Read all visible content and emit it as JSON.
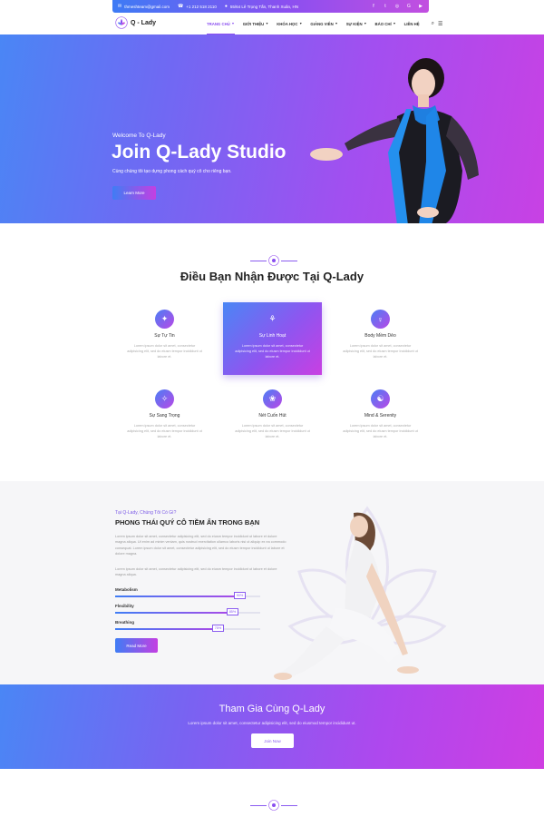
{
  "topbar": {
    "email": "thmeshteam@gmail.com",
    "phone": "+1 212 518 2110",
    "address": "55/64 Lê Trọng Tấn, Thanh Xuân, HN",
    "social_icons": [
      "facebook-icon",
      "twitter-icon",
      "instagram-icon",
      "google-plus-icon",
      "youtube-icon"
    ]
  },
  "header": {
    "logo_text": "Q - Lady",
    "nav": [
      {
        "label": "TRANG CHỦ",
        "dropdown": true,
        "active": true
      },
      {
        "label": "GIỚI THIỆU",
        "dropdown": true
      },
      {
        "label": "KHÓA HỌC",
        "dropdown": true
      },
      {
        "label": "GIẢNG VIÊN",
        "dropdown": true
      },
      {
        "label": "SỰ KIỆN",
        "dropdown": true
      },
      {
        "label": "BÁO CHÍ",
        "dropdown": true
      },
      {
        "label": "LIÊN HỆ",
        "dropdown": false
      }
    ]
  },
  "hero": {
    "welcome": "Welcome To Q-Lady",
    "title": "Join Q-Lady Studio",
    "subtitle": "Cùng chúng tôi tạo dựng phong cách quý cô cho riêng bạn.",
    "button": "Learn More"
  },
  "features": {
    "title": "Điều Bạn Nhận Được Tại Q-Lady",
    "items": [
      {
        "title": "Sự Tự Tin",
        "desc": "Lorem ipsum dolor sit amet, consectetur adipisicing elit, sed do eiusm tempor incididunt ut labore et."
      },
      {
        "title": "Sự Linh Hoạt",
        "desc": "Lorem ipsum dolor sit amet, consectetur adipisicing elit, sed do eiusm tempor incididunt ut labore et."
      },
      {
        "title": "Body Mềm Dẻo",
        "desc": "Lorem ipsum dolor sit amet, consectetur adipisicing elit, sed do eiusm tempor incididunt ut labore et."
      },
      {
        "title": "Sự Sang Trọng",
        "desc": "Lorem ipsum dolor sit amet, consectetur adipisicing elit, sed do eiusm tempor incididunt ut labore et."
      },
      {
        "title": "Nét Cuốn Hút",
        "desc": "Lorem ipsum dolor sit amet, consectetur adipisicing elit, sed do eiusm tempor incididunt ut labore et."
      },
      {
        "title": "Mind & Serenity",
        "desc": "Lorem ipsum dolor sit amet, consectetur adipisicing elit, sed do eiusm tempor incididunt ut labore et."
      }
    ]
  },
  "about": {
    "kicker": "Tại Q-Lady, Chúng Tôi Có Gì?",
    "title": "PHONG THÁI QUÝ CÔ TIỀM ẨN TRONG BẠN",
    "para1": "Lorem ipsum dolor sit amet, consectetur adipisicing elit, sed do eiusm tempor incididunt ut labore et dolore magna aliqua. Ut enim ad minim veniam, quis nostrud exercitation ullamco laboris nisi ut aliquip ex ea commodo consequat. Lorem ipsum dolor sit amet, consectetur adipisicing elit, sed do eiusm tempor incididunt ut labore et dolore magna.",
    "para2": "Lorem ipsum dolor sit amet, consectetur adipisicing elit, sed do eiusm tempor incididunt ut labore et dolore magna aliqua.",
    "skills": [
      {
        "label": "Metabolism",
        "percent": 90,
        "percent_text": "90%"
      },
      {
        "label": "Flexibility",
        "percent": 85,
        "percent_text": "85%"
      },
      {
        "label": "Breathing",
        "percent": 75,
        "percent_text": "75%"
      }
    ],
    "button": "Read More"
  },
  "cta": {
    "title": "Tham Gia Cùng Q-Lady",
    "subtitle": "Lorem ipsum dolor sit amet, consectetur adipisicing elit, sed do eiusmod tempor incididunt ut.",
    "button": "Join Now"
  },
  "colors": {
    "accent": "#8a4ef0",
    "gradient_start": "#4a86f5",
    "gradient_end": "#c841e4"
  }
}
